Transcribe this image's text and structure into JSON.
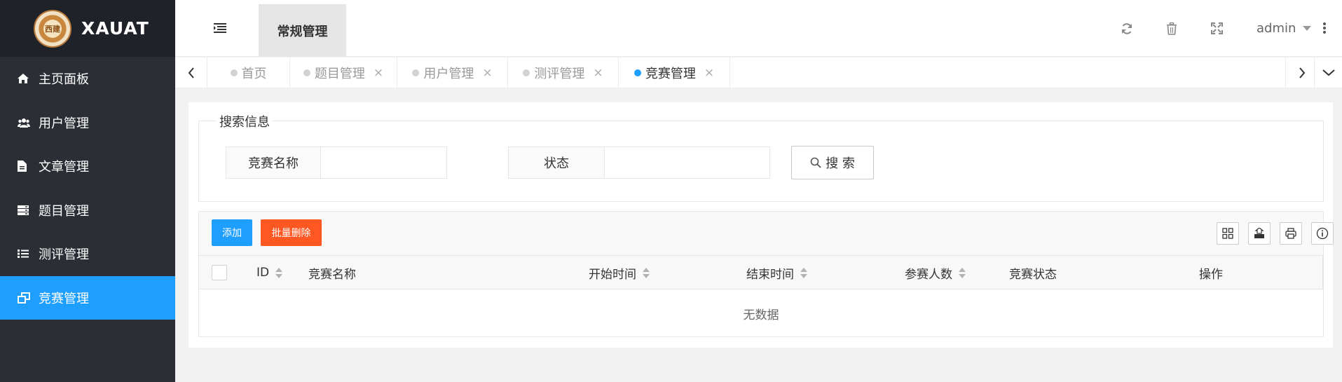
{
  "logo": {
    "text": "XAUAT",
    "badge": "西建"
  },
  "sidebar": {
    "items": [
      {
        "label": "主页面板",
        "icon": "home-icon"
      },
      {
        "label": "用户管理",
        "icon": "users-icon"
      },
      {
        "label": "文章管理",
        "icon": "file-icon"
      },
      {
        "label": "题目管理",
        "icon": "server-icon"
      },
      {
        "label": "测评管理",
        "icon": "list-icon"
      },
      {
        "label": "竞赛管理",
        "icon": "window-restore-icon",
        "active": true
      }
    ]
  },
  "header": {
    "tab_label": "常规管理",
    "user": "admin",
    "icons": [
      "refresh-icon",
      "trash-icon",
      "fullscreen-icon"
    ]
  },
  "tabs": {
    "items": [
      {
        "label": "首页",
        "closable": false
      },
      {
        "label": "题目管理",
        "closable": true
      },
      {
        "label": "用户管理",
        "closable": true
      },
      {
        "label": "测评管理",
        "closable": true
      },
      {
        "label": "竞赛管理",
        "closable": true,
        "active": true
      }
    ],
    "close_glyph": "×"
  },
  "search": {
    "legend": "搜索信息",
    "name_label": "竞赛名称",
    "name_value": "",
    "status_label": "状态",
    "status_value": "",
    "button_label": "搜 索"
  },
  "table": {
    "add_label": "添加",
    "batch_delete_label": "批量删除",
    "toolbar_icons": [
      "columns-icon",
      "export-icon",
      "print-icon",
      "info-icon"
    ],
    "columns": [
      "ID",
      "竞赛名称",
      "开始时间",
      "结束时间",
      "参赛人数",
      "竞赛状态",
      "操作"
    ],
    "empty_text": "无数据"
  },
  "colors": {
    "sidebar_bg": "#2b2e35",
    "logo_bg": "#20222a",
    "accent": "#1e9fff",
    "danger": "#ff5722"
  }
}
